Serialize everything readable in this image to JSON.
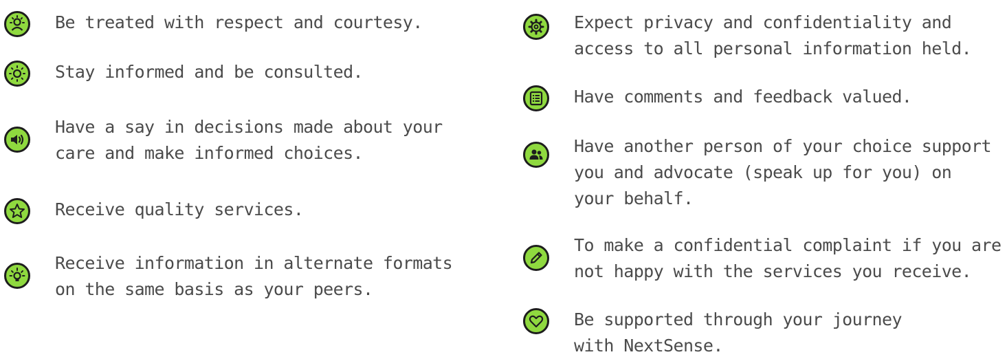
{
  "accent_color": "#8fd93f",
  "icon_outline_color": "#1d1d1d",
  "text_color": "#4b4b4b",
  "left_items": [
    {
      "icon": "person-icon",
      "text": "Be treated with respect and courtesy."
    },
    {
      "icon": "sun-icon",
      "text": "Stay informed and be consulted."
    },
    {
      "icon": "speaker-icon",
      "text": "Have a say in decisions made about your\ncare and make informed choices."
    },
    {
      "icon": "star-icon",
      "text": "Receive quality services."
    },
    {
      "icon": "lightbulb-icon",
      "text": "Receive information in alternate formats\non the same basis as your peers."
    }
  ],
  "right_items": [
    {
      "icon": "gear-icon",
      "text": "Expect privacy and confidentiality and\naccess to all personal information held."
    },
    {
      "icon": "list-icon",
      "text": "Have comments and feedback valued."
    },
    {
      "icon": "people-icon",
      "text": "Have another person of your choice support\nyou and advocate (speak up for you) on\nyour behalf."
    },
    {
      "icon": "pencil-icon",
      "text": "To make a confidential complaint if you are\nnot happy with the services you receive."
    },
    {
      "icon": "heart-icon",
      "text": "Be supported through your journey\nwith NextSense."
    }
  ]
}
